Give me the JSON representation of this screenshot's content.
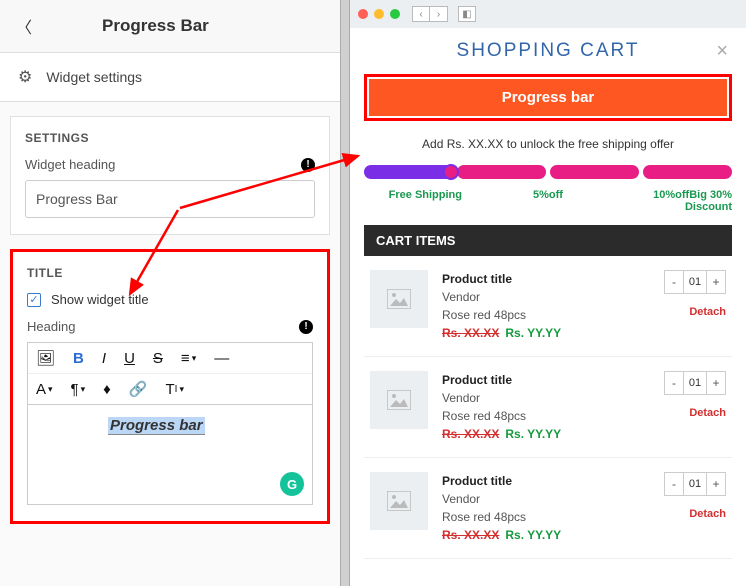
{
  "header": {
    "title": "Progress Bar"
  },
  "widget_settings_row": {
    "label": "Widget settings"
  },
  "settings": {
    "section_title": "SETTINGS",
    "widget_heading_label": "Widget heading",
    "widget_heading_value": "Progress Bar"
  },
  "title_section": {
    "section_title": "TITLE",
    "show_widget_title_label": "Show widget title",
    "show_widget_title_checked": true,
    "heading_label": "Heading",
    "editor_value": "Progress bar"
  },
  "preview": {
    "cart_title": "SHOPPING CART",
    "progress_bar_label": "Progress bar",
    "unlock_text": "Add Rs. XX.XX to unlock the free shipping offer",
    "labels": {
      "free_shipping": "Free Shipping",
      "five_off": "5%off",
      "ten_off": "10%off",
      "big_discount": "Big 30% Discount"
    },
    "cart_items_header": "CART ITEMS",
    "items": [
      {
        "title": "Product title",
        "vendor": "Vendor",
        "variant": "Rose red 48pcs",
        "price_old": "Rs. XX.XX",
        "price_new": "Rs. YY.YY",
        "qty": "01",
        "detach": "Detach"
      },
      {
        "title": "Product title",
        "vendor": "Vendor",
        "variant": "Rose red 48pcs",
        "price_old": "Rs. XX.XX",
        "price_new": "Rs. YY.YY",
        "qty": "01",
        "detach": "Detach"
      },
      {
        "title": "Product title",
        "vendor": "Vendor",
        "variant": "Rose red 48pcs",
        "price_old": "Rs. XX.XX",
        "price_new": "Rs. YY.YY",
        "qty": "01",
        "detach": "Detach"
      }
    ]
  }
}
